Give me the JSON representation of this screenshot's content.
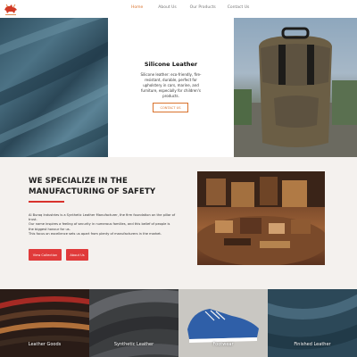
{
  "nav": {
    "logo_icon": "bull-logo-icon",
    "links": [
      "Home",
      "About Us",
      "Our Products",
      "Contact Us"
    ],
    "active_color": "#d9722c"
  },
  "hero": {
    "title": "Silicone Leather",
    "description": "Silicone leather: eco-friendly, fire-resistant, durable, perfect for upholstery in cars, marine, and furniture, especially for children's products.",
    "button_label": "CONTACT US",
    "accent_color": "#d9722c"
  },
  "specialize": {
    "heading_line1": "WE SPECIALIZE IN THE",
    "heading_line2": "MANUFACTURING OF SAFETY",
    "paragraph_1": "Al Buraq Industries is a Synthetic Leather Manufacturer, the firm foundation on the pillar of trust.",
    "paragraph_2": "Our name inspires a feeling of security in numerous families, and this belief of people is the biggest honour for us.",
    "paragraph_3": "This focus on excellence sets us apart from plenty of manufacturers in the market.",
    "button_collection": "View Collection",
    "button_about": "About Us",
    "button_color": "#e03a3a"
  },
  "categories": [
    {
      "label": "Leather Goods"
    },
    {
      "label": "Synthetic Leather"
    },
    {
      "label": "Footwear"
    },
    {
      "label": "Finished Leather"
    }
  ]
}
